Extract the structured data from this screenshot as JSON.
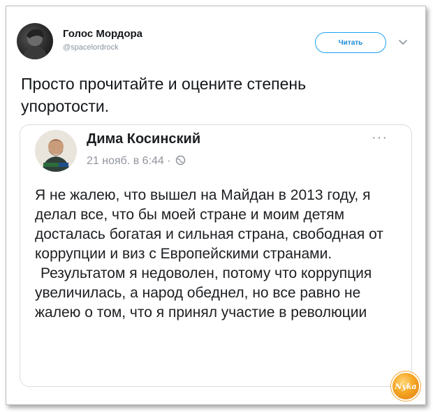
{
  "tweet": {
    "author_name": "Голос Мордора",
    "author_handle": "@spacelordrock",
    "follow_label": "Читать",
    "text": "Просто прочитайте и оцените степень упоротости."
  },
  "embedded_post": {
    "author_name": "Дима Косинский",
    "meta": "21 нояб. в 6:44 ·",
    "more_label": "···",
    "paragraphs": [
      "Я не жалею, что вышел на Майдан в 2013 году, я делал все, что бы моей стране и моим детям досталась богатая и сильная страна, свободная от коррупции и виз с Европейскими странами.",
      "Результатом я недоволен, потому что коррупция увеличилась, а народ обеднел, но все равно не жалею о том, что я принял участие в революции"
    ]
  },
  "watermark": {
    "text": "Nyka"
  },
  "colors": {
    "accent": "#1da1f2",
    "text": "#14171a",
    "muted": "#8a959e"
  }
}
